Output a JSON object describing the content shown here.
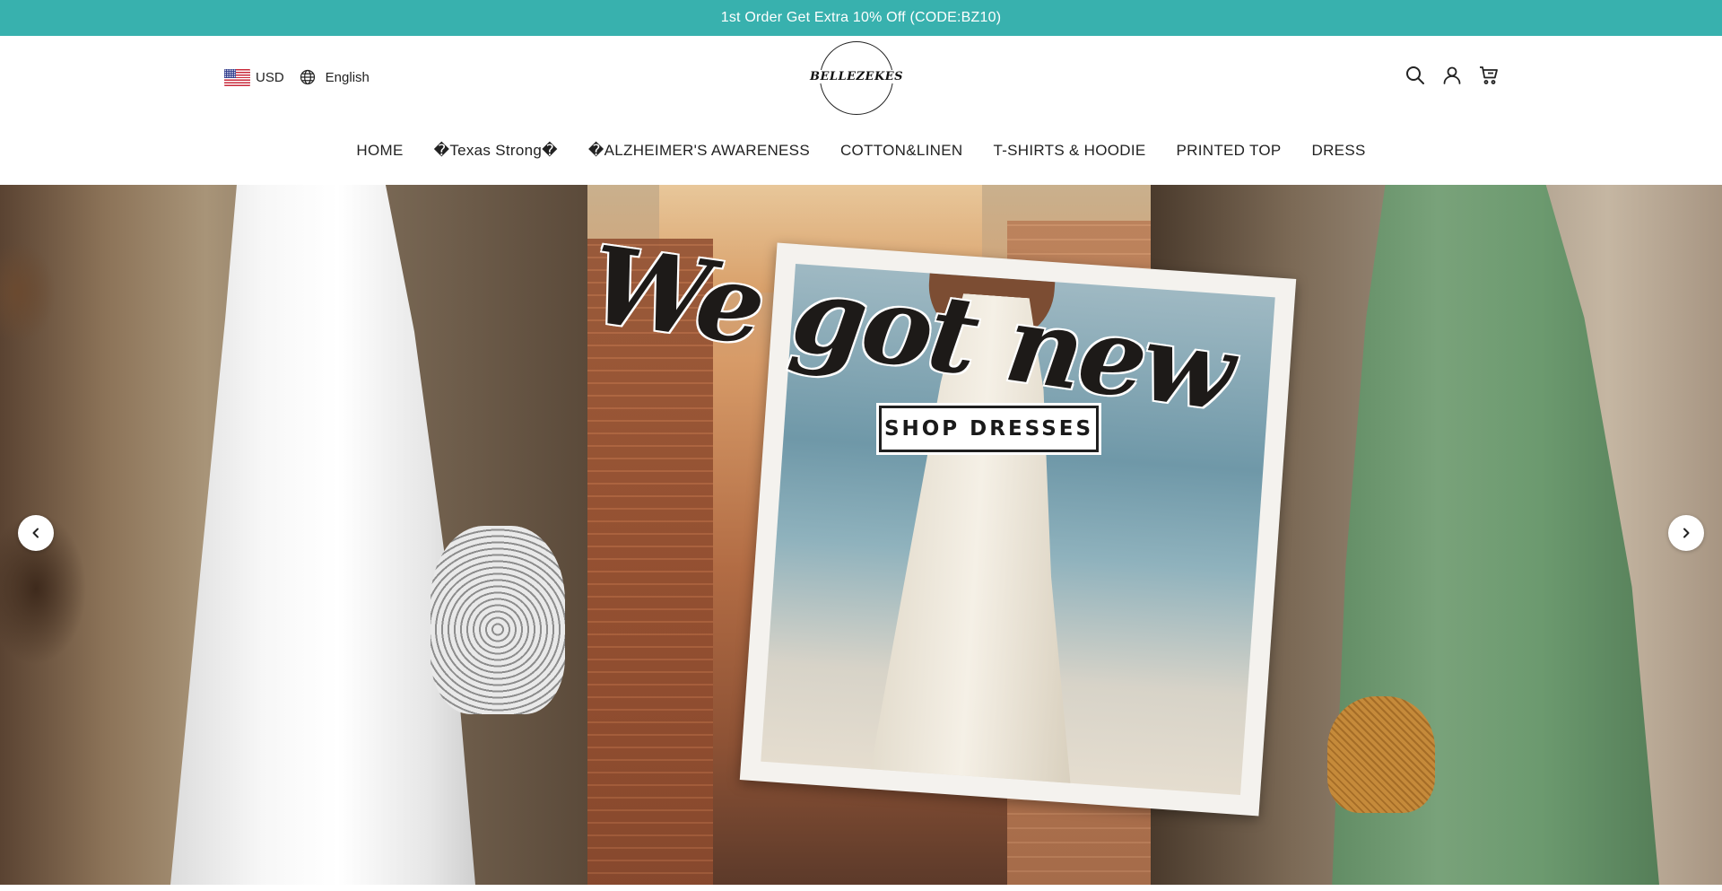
{
  "announcement": {
    "text": "1st Order Get Extra 10% Off (CODE:BZ10)",
    "background": "#38b1ae"
  },
  "header": {
    "currency": {
      "label": "USD",
      "flag": "us-flag-icon"
    },
    "language": {
      "label": "English",
      "icon": "globe-icon"
    },
    "logo": {
      "text": "BELLEZEKES"
    },
    "actions": [
      {
        "name": "search",
        "icon": "search-icon"
      },
      {
        "name": "account",
        "icon": "user-icon"
      },
      {
        "name": "cart",
        "icon": "cart-icon"
      }
    ]
  },
  "nav": {
    "items": [
      {
        "label": "HOME"
      },
      {
        "label": "�Texas Strong�"
      },
      {
        "label": "�ALZHEIMER'S AWARENESS"
      },
      {
        "label": "COTTON&LINEN"
      },
      {
        "label": "T-SHIRTS & HOODIE"
      },
      {
        "label": "PRINTED TOP"
      },
      {
        "label": "DRESS"
      }
    ]
  },
  "hero": {
    "headline": "We got new",
    "cta_label": "SHOP DRESSES",
    "prev_icon": "chevron-left-icon",
    "next_icon": "chevron-right-icon"
  }
}
